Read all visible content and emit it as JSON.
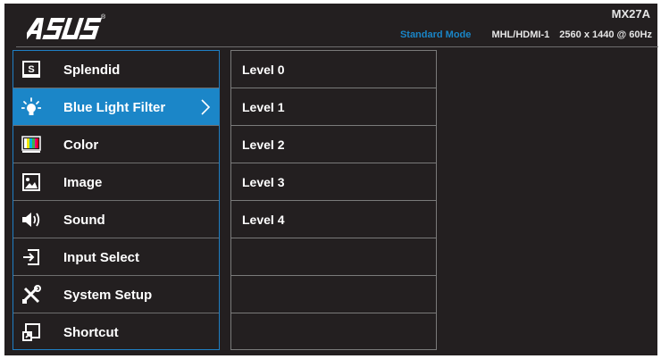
{
  "brand": {
    "logo": "ASUS",
    "registered": "®"
  },
  "model": "MX27A",
  "status": {
    "mode": "Standard Mode",
    "input": "MHL/HDMI-1",
    "resolution": "2560 x 1440 @ 60Hz"
  },
  "colors": {
    "background": "#231f20",
    "accent": "#1b86c8",
    "divider": "#6e6e6e",
    "text": "#ffffff"
  },
  "menu": {
    "selected": "Blue Light Filter",
    "items": [
      {
        "label": "Splendid",
        "icon": "splendid-icon"
      },
      {
        "label": "Blue Light Filter",
        "icon": "bulb-icon"
      },
      {
        "label": "Color",
        "icon": "color-bars-icon"
      },
      {
        "label": "Image",
        "icon": "image-icon"
      },
      {
        "label": "Sound",
        "icon": "speaker-icon"
      },
      {
        "label": "Input Select",
        "icon": "input-icon"
      },
      {
        "label": "System Setup",
        "icon": "tools-icon"
      },
      {
        "label": "Shortcut",
        "icon": "shortcut-icon"
      }
    ]
  },
  "submenu": {
    "items": [
      {
        "label": "Level 0"
      },
      {
        "label": "Level 1"
      },
      {
        "label": "Level 2"
      },
      {
        "label": "Level 3"
      },
      {
        "label": "Level 4"
      },
      {
        "label": ""
      },
      {
        "label": ""
      },
      {
        "label": ""
      }
    ]
  }
}
